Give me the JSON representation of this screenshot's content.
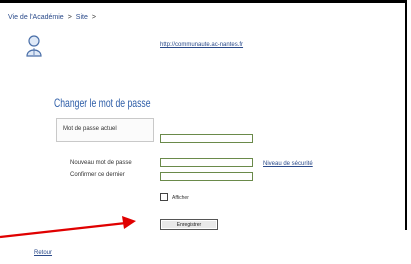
{
  "breadcrumb": {
    "item1": "Vie de l'Académie",
    "separator": ">",
    "item2": "Site",
    "trailing": ">"
  },
  "profile": {
    "link": "http://communaute.ac-nantes.fr"
  },
  "form": {
    "title": "Changer le mot de passe",
    "current_password_label": "Mot de passe actuel",
    "new_password_label": "Nouveau mot de passe",
    "confirm_label": "Confirmer ce dernier",
    "security_link": "Niveau de sécurité",
    "show_label": "Afficher",
    "save_button": "Enregistrer"
  },
  "footer": {
    "back_link": "Retour"
  },
  "colors": {
    "link": "#2a4a8a",
    "title": "#2e5ea8",
    "arrow": "#e00000"
  }
}
